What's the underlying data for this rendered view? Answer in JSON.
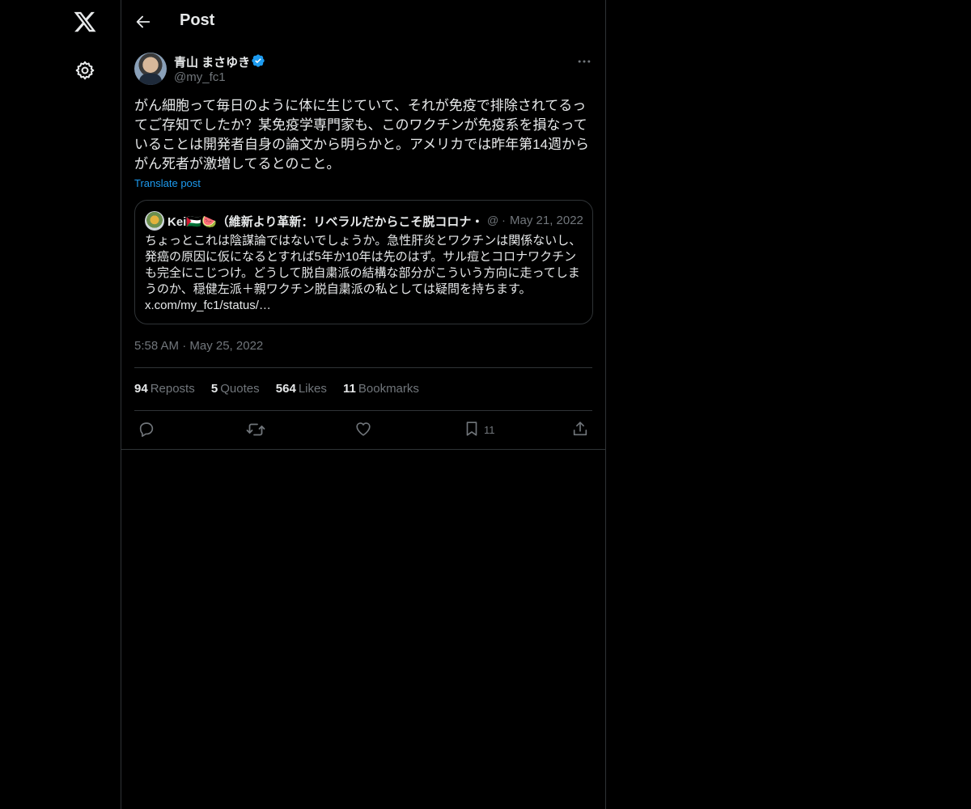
{
  "header": {
    "title": "Post"
  },
  "post": {
    "author_name": "青山 まさゆき",
    "author_handle": "@my_fc1",
    "text": "がん細胞って毎日のように体に生じていて、それが免疫で排除されてるってご存知でしたか？某免疫学専門家も、このワクチンが免疫系を損なっていることは開発者自身の論文から明らかと。アメリカでは昨年第14週からがん死者が激増してるとのこと。",
    "translate_label": "Translate post",
    "timestamp": "5:58 AM · May 25, 2022"
  },
  "quote": {
    "author_name": "Kei🇵🇸🍉（維新より革新：リベラルだからこそ脱コロナ・",
    "handle": "@ ·",
    "date": "May 21, 2022",
    "text": "ちょっとこれは陰謀論ではないでしょうか。急性肝炎とワクチンは関係ないし、発癌の原因に仮になるとすれば5年か10年は先のはず。サル痘とコロナワクチンも完全にこじつけ。どうして脱自粛派の結構な部分がこういう方向に走ってしまうのか、穏健左派＋親ワクチン脱自粛派の私としては疑問を持ちます。 x.com/my_fc1/status/…"
  },
  "stats": {
    "reposts_count": "94",
    "reposts_label": "Reposts",
    "quotes_count": "5",
    "quotes_label": "Quotes",
    "likes_count": "564",
    "likes_label": "Likes",
    "bookmarks_count": "11",
    "bookmarks_label": "Bookmarks"
  },
  "actions": {
    "bookmark_count": "11"
  },
  "icons": [
    "x-logo-icon",
    "settings-icon",
    "back-arrow-icon",
    "verified-icon",
    "more-icon",
    "reply-icon",
    "repost-icon",
    "like-icon",
    "bookmark-icon",
    "share-icon"
  ],
  "colors": {
    "background": "#000000",
    "text": "#e7e9ea",
    "muted": "#71767b",
    "accent": "#1d9bf0",
    "border": "#2f3336"
  }
}
